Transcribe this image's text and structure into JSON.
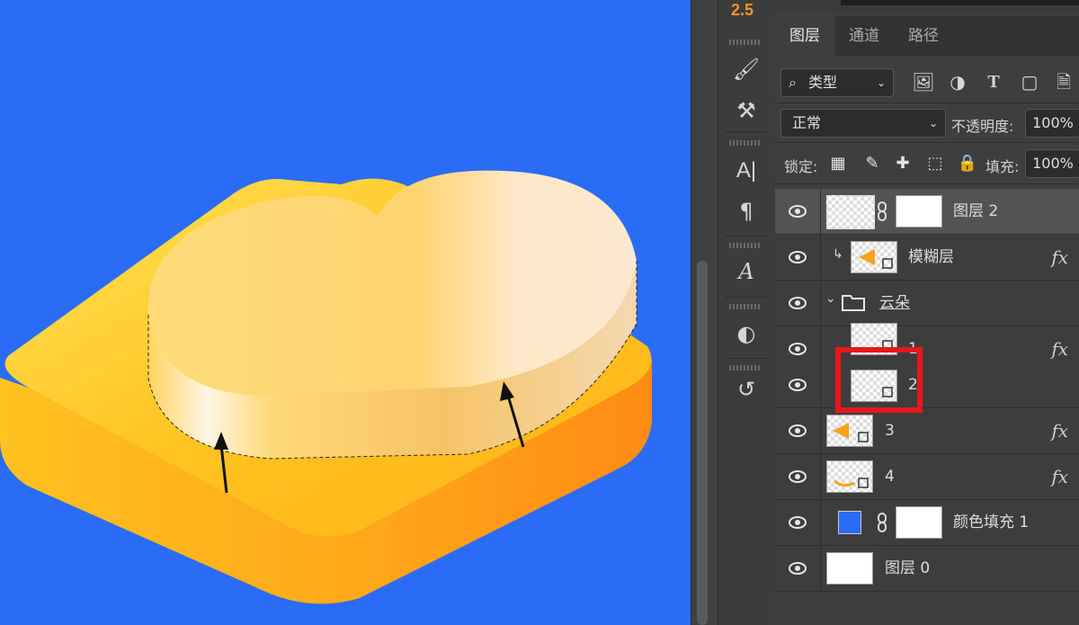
{
  "version": "2.5",
  "tabs": [
    {
      "label": "图层",
      "active": true
    },
    {
      "label": "通道",
      "active": false
    },
    {
      "label": "路径",
      "active": false
    }
  ],
  "filter": {
    "label": "类型",
    "icons": [
      "image-filter-icon",
      "adjustment-filter-icon",
      "type-filter-icon",
      "shape-filter-icon",
      "smart-object-filter-icon"
    ]
  },
  "blend_mode": "正常",
  "opacity": {
    "label": "不透明度:",
    "value": "100%"
  },
  "lock": {
    "label": "锁定:",
    "icons": [
      "lock-transparency-icon",
      "lock-paint-icon",
      "lock-position-icon",
      "lock-artboard-icon",
      "lock-all-icon"
    ]
  },
  "fill": {
    "label": "填充:",
    "value": "100%"
  },
  "layers": [
    {
      "name": "图层 2",
      "selected": true,
      "thumb": "checker",
      "mask": true,
      "fx": false
    },
    {
      "name": "模糊层",
      "selected": false,
      "thumb": "checker-orange",
      "clipped": true,
      "fx": true
    },
    {
      "name": "云朵",
      "selected": false,
      "group": true,
      "fx": false
    },
    {
      "name": "1",
      "selected": false,
      "thumb": "checker",
      "fx": true
    },
    {
      "name": "2",
      "selected": false,
      "thumb": "checker",
      "fx": false
    },
    {
      "name": "3",
      "selected": false,
      "thumb": "checker-orange",
      "fx": true
    },
    {
      "name": "4",
      "selected": false,
      "thumb": "checker-curve",
      "fx": true
    },
    {
      "name": "颜色填充 1",
      "selected": false,
      "thumb": "blue-swatch",
      "mask": true,
      "fx": false
    },
    {
      "name": "图层 0",
      "selected": false,
      "thumb": "white",
      "fx": false
    }
  ],
  "fx_label": "fx",
  "colors": {
    "canvas": "#2a6cf6",
    "highlight": "#e8171b",
    "accent": "#f0932b"
  }
}
